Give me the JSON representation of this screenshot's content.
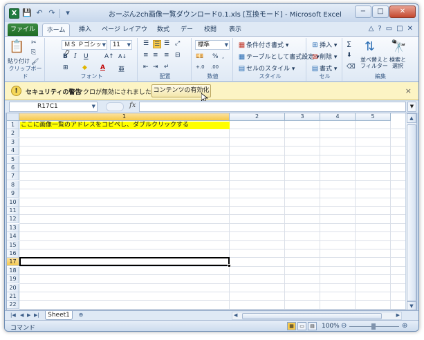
{
  "window": {
    "title": "おーぷん2ch画像一覧ダウンロード0.1.xls [互換モード] - Microsoft Excel",
    "logo": "X",
    "controls": {
      "minimize": "−",
      "maximize": "□",
      "close": "✕"
    }
  },
  "qat": {
    "save": "💾",
    "undo": "↶",
    "redo": "↷",
    "customize": "▾"
  },
  "tabs": {
    "file": "ファイル",
    "home": "ホーム",
    "insert": "挿入",
    "layout": "ページ レイアウト",
    "formulas": "数式",
    "data": "データ",
    "review": "校閲",
    "view": "表示"
  },
  "ribbon_right": {
    "minimize": "△",
    "help": "?",
    "restore": "▭",
    "restore2": "□",
    "close": "✕"
  },
  "ribbon": {
    "clipboard": {
      "label": "クリップボード",
      "paste": "貼り付け",
      "cut": "✂",
      "copy": "⎘",
      "format_painter": "🖌"
    },
    "font": {
      "label": "フォント",
      "name": "ＭＳ Ｐゴシック",
      "size": "11",
      "bold": "B",
      "italic": "I",
      "underline": "U",
      "grow": "A↑",
      "shrink": "A↓",
      "border": "⊞",
      "fill": "◆",
      "color": "A",
      "phonetic": "亜"
    },
    "alignment": {
      "label": "配置"
    },
    "number": {
      "label": "数値",
      "format": "標準",
      "percent": "%",
      "comma": ",",
      "dec_inc": "+.0",
      "dec_dec": ".00"
    },
    "styles": {
      "label": "スタイル",
      "conditional": "条件付き書式",
      "table": "テーブルとして書式設定",
      "cell": "セルのスタイル"
    },
    "cells": {
      "label": "セル",
      "insert": "挿入",
      "delete": "削除",
      "format": "書式"
    },
    "editing": {
      "label": "編集",
      "sum": "Σ",
      "sort": "並べ替えと",
      "sort2": "フィルター",
      "find": "検索と",
      "find2": "選択"
    }
  },
  "security": {
    "title": "セキュリティの警告",
    "message": "マクロが無効にされました。",
    "button": "コンテンツの有効化",
    "close": "×"
  },
  "formula_bar": {
    "name_box": "R17C1",
    "fx": "fx",
    "value": ""
  },
  "grid": {
    "columns": [
      "1",
      "2",
      "3",
      "4",
      "5"
    ],
    "rows": [
      "1",
      "2",
      "3",
      "4",
      "5",
      "6",
      "7",
      "8",
      "9",
      "10",
      "11",
      "12",
      "13",
      "14",
      "15",
      "16",
      "17",
      "18",
      "19",
      "20",
      "21",
      "22"
    ],
    "cell_a1": "ここに画像一覧のアドレスをコピペし、ダブルクリックする",
    "active_row": "17",
    "highlight_color": "#ffff00"
  },
  "sheets": {
    "tab": "Sheet1",
    "new": "⊕"
  },
  "status": {
    "mode": "コマンド",
    "zoom": "100%",
    "zoom_minus": "⊖",
    "zoom_plus": "⊕"
  }
}
